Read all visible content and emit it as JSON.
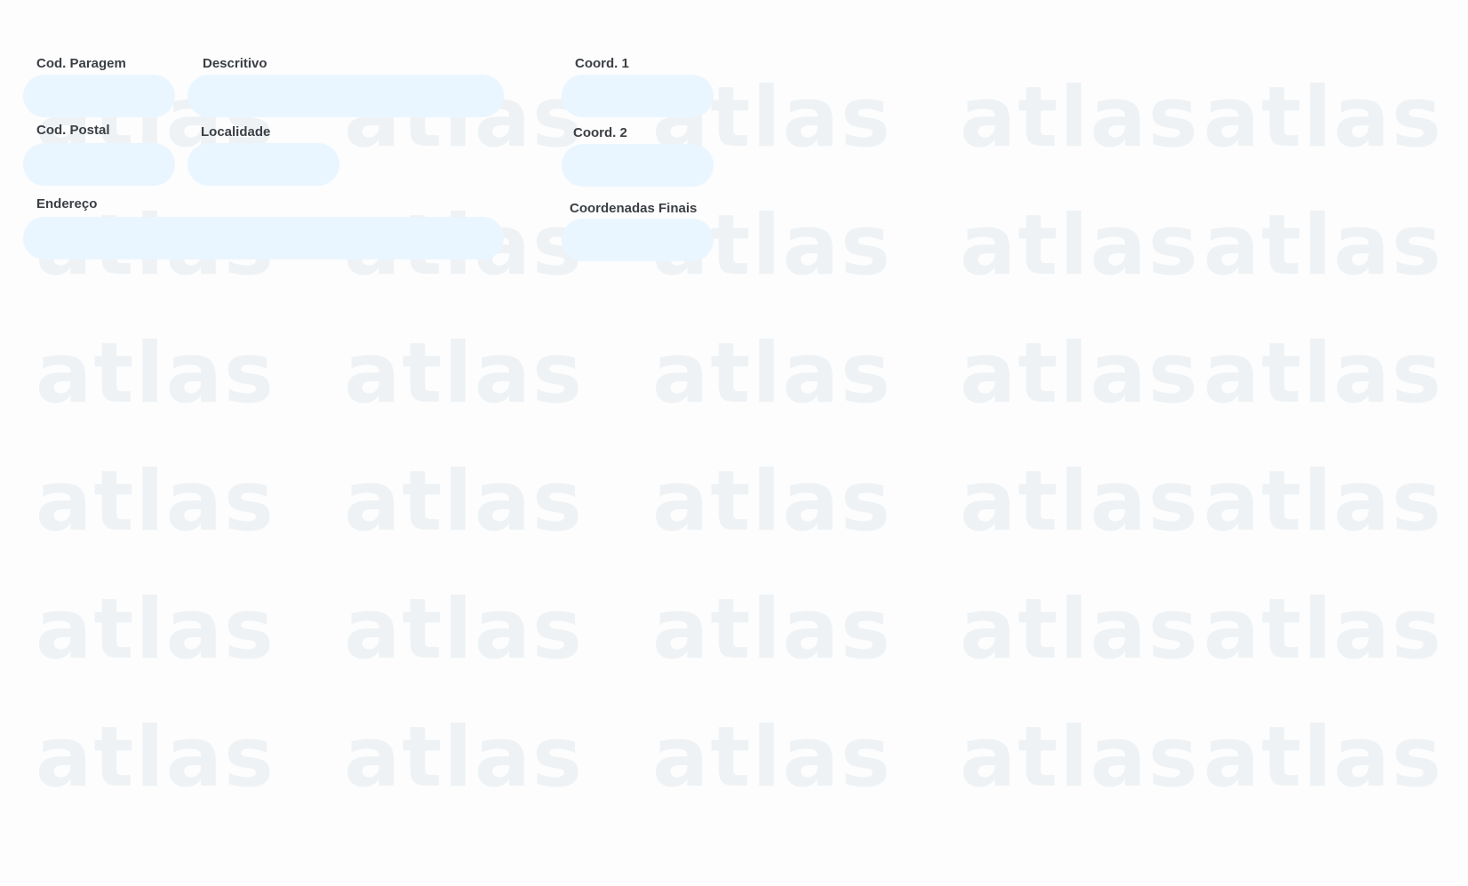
{
  "watermark": {
    "text": "atlas"
  },
  "form": {
    "cod_paragem": {
      "label": "Cod. Paragem",
      "value": ""
    },
    "descritivo": {
      "label": "Descritivo",
      "value": ""
    },
    "coord1": {
      "label": "Coord. 1",
      "value": ""
    },
    "cod_postal": {
      "label": "Cod. Postal",
      "value": ""
    },
    "localidade": {
      "label": "Localidade",
      "value": ""
    },
    "coord2": {
      "label": "Coord. 2",
      "value": ""
    },
    "endereco": {
      "label": "Endereço",
      "value": ""
    },
    "coordenadas_finais": {
      "label": "Coordenadas Finais",
      "value": ""
    }
  }
}
